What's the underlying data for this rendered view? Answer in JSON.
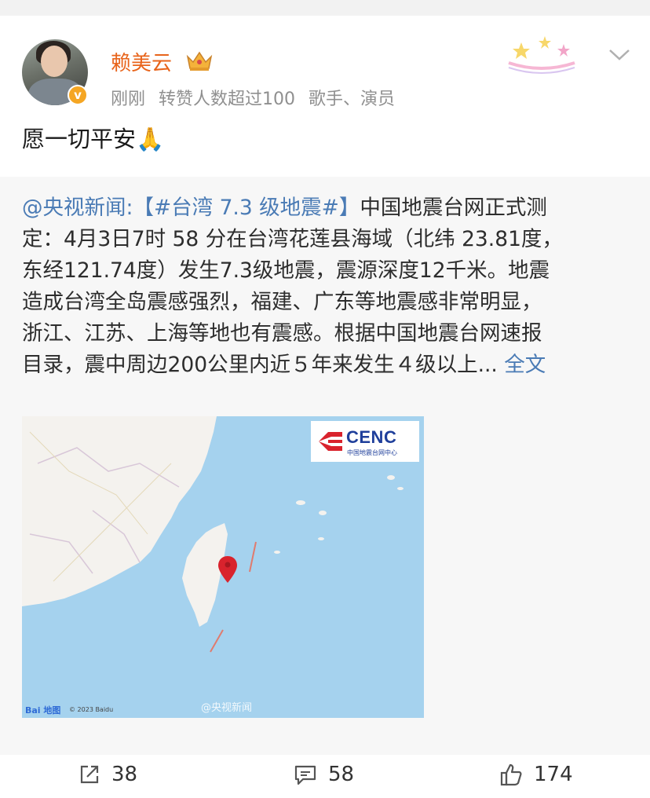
{
  "post": {
    "author": {
      "name": "赖美云",
      "verified_mark": "v",
      "timestamp": "刚刚",
      "repost_note": "转赞人数超过100",
      "profession": "歌手、演员"
    },
    "content": "愿一切平安🙏",
    "icons": [
      "crown-icon",
      "verified-badge-icon",
      "decoration-sticker-icon",
      "chevron-down-icon",
      "pray-emoji"
    ]
  },
  "repost": {
    "source": "@央视新闻:",
    "hashtag_open": "【",
    "hashtag": "#台湾 7.3 级地震#",
    "hashtag_close": "】",
    "lines": [
      "中国地震台网正式测",
      "定：4月3日7时 58 分在台湾花莲县海域（北纬 23.81度，",
      "东经121.74度）发生7.3级地震，震源深度12千米。地震",
      "造成台湾全岛震感强烈，福建、广东等地震感非常明显，",
      "浙江、江苏、上海等地也有震感。根据中国地震台网速报",
      "目录，震中周边200公里内近５年来发生４级以上..."
    ],
    "full_text_link": "全文",
    "map": {
      "logo_text": "CENC",
      "logo_subtext": "中国地震台网中心",
      "watermark": "@央视新闻",
      "baidu": "Bai 地图",
      "copyright": "© 2023 Baidu"
    }
  },
  "actions": {
    "share_count": "38",
    "comment_count": "58",
    "like_count": "174"
  },
  "colors": {
    "username": "#e8641b",
    "link": "#4a7bb5",
    "sea": "#a5d2ee",
    "epicenter": "#d9232d"
  }
}
